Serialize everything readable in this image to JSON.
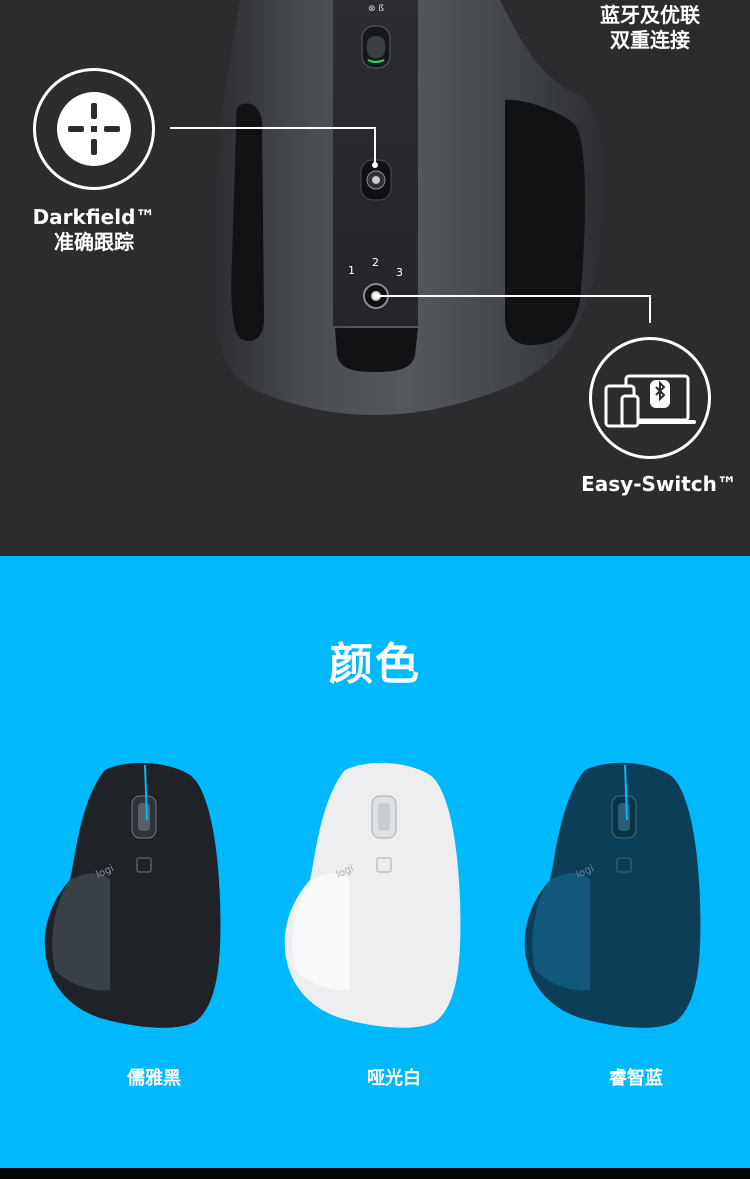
{
  "features": {
    "bluetooth": {
      "line1": "蓝牙及优联",
      "line2": "双重连接"
    },
    "darkfield": {
      "line1": "Darkfield™",
      "line2": "准确跟踪",
      "icon": "crosshair-icon"
    },
    "easyswitch": {
      "label": "Easy-Switch™",
      "icon": "devices-bluetooth-icon"
    },
    "channels": [
      "1",
      "2",
      "3"
    ]
  },
  "colors_section": {
    "title": "颜色",
    "options": [
      {
        "label": "儒雅黑",
        "color": "#1f2328"
      },
      {
        "label": "哑光白",
        "color": "#eceef0"
      },
      {
        "label": "睿智蓝",
        "color": "#0c3f57"
      }
    ],
    "brand": "logi"
  },
  "theme": {
    "top_bg": "#2c2c2e",
    "accent": "#00b8fc"
  }
}
